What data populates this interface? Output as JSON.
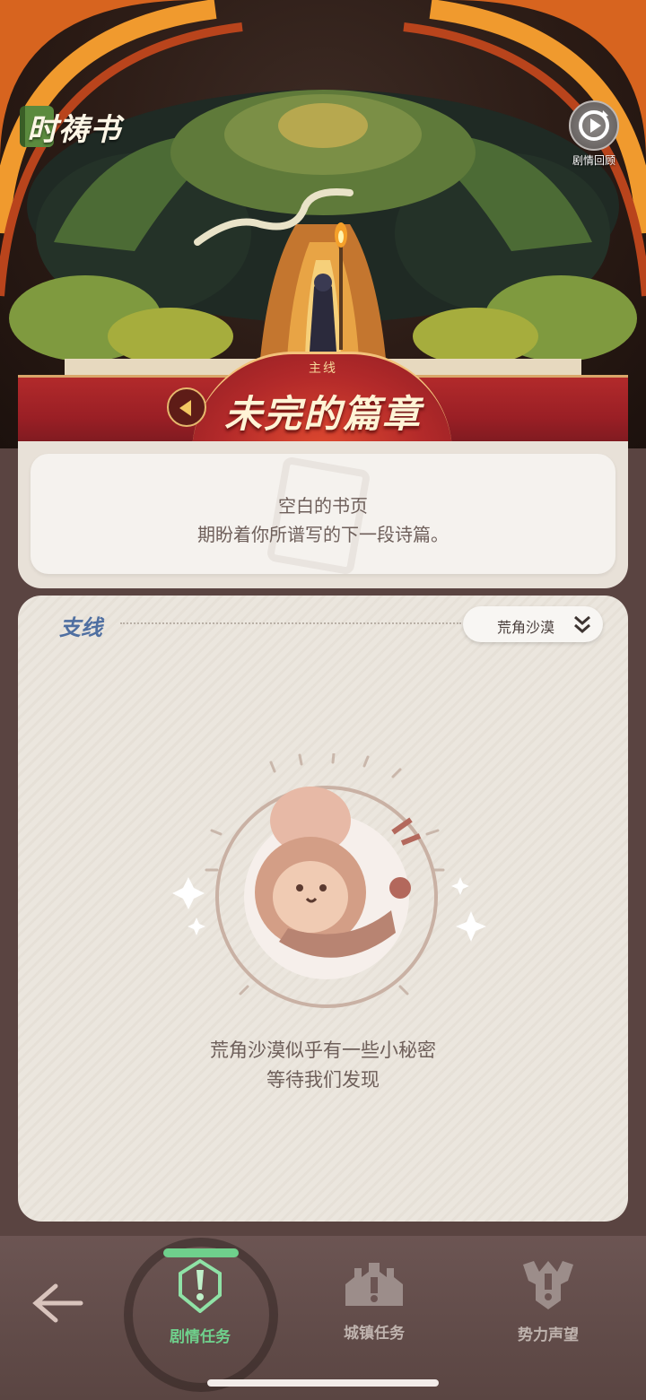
{
  "app": {
    "logo_text": "时祷书"
  },
  "header": {
    "recap_label": "剧情回顾"
  },
  "main_quest": {
    "tag": "主线",
    "chapter_title": "未完的篇章",
    "empty_title": "空白的书页",
    "empty_desc": "期盼着你所谱写的下一段诗篇。"
  },
  "side_quest": {
    "label": "支线",
    "region_selected": "荒角沙漠",
    "hint_line1": "荒角沙漠似乎有一些小秘密",
    "hint_line2": "等待我们发现"
  },
  "bottom_nav": {
    "items": [
      {
        "label": "剧情任务",
        "active": true,
        "icon": "story-quest-icon"
      },
      {
        "label": "城镇任务",
        "active": false,
        "icon": "town-quest-icon"
      },
      {
        "label": "势力声望",
        "active": false,
        "icon": "faction-reputation-icon"
      }
    ]
  },
  "colors": {
    "active_green": "#6fd08c",
    "inactive_label": "#bfb3ae",
    "banner_red": "#b22a2b",
    "side_label_blue": "#4f6fa1"
  }
}
